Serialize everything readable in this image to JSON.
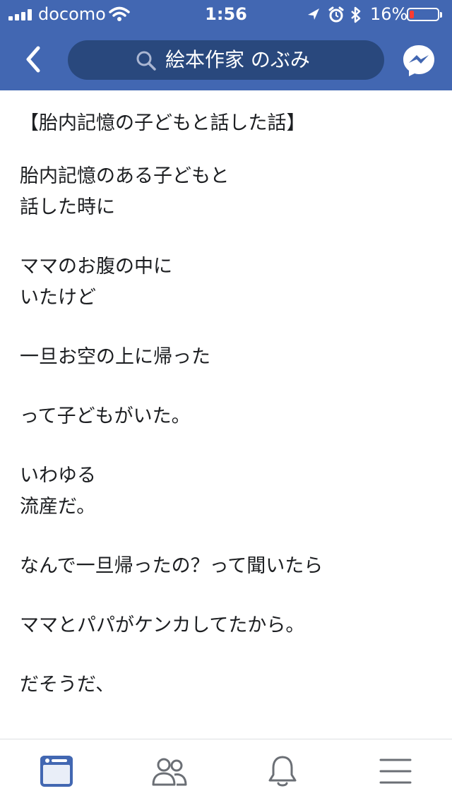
{
  "status_bar": {
    "carrier": "docomo",
    "time": "1:56",
    "battery_percent": "16%",
    "battery_level": 0.16
  },
  "header": {
    "search_text": "絵本作家 のぶみ"
  },
  "post": {
    "title": "【胎内記憶の子どもと話した話】",
    "paragraphs": [
      [
        "胎内記憶のある子どもと",
        "話した時に"
      ],
      [
        "ママのお腹の中に",
        "いたけど"
      ],
      [
        "一旦お空の上に帰った"
      ],
      [
        "って子どもがいた。"
      ],
      [
        "いわゆる",
        "流産だ。"
      ],
      [
        "なんで一旦帰ったの？って聞いたら"
      ],
      [
        "ママとパパがケンカしてたから。"
      ],
      [
        "だそうだ、"
      ]
    ]
  },
  "tab_bar": {
    "tabs": [
      "news-feed-icon",
      "friends-icon",
      "notifications-icon",
      "menu-icon"
    ],
    "active_index": 0
  },
  "colors": {
    "brand_blue": "#4267b2",
    "search_bg": "#29487d",
    "active_tab": "#4267b2",
    "inactive_tab": "#6b6f75"
  }
}
